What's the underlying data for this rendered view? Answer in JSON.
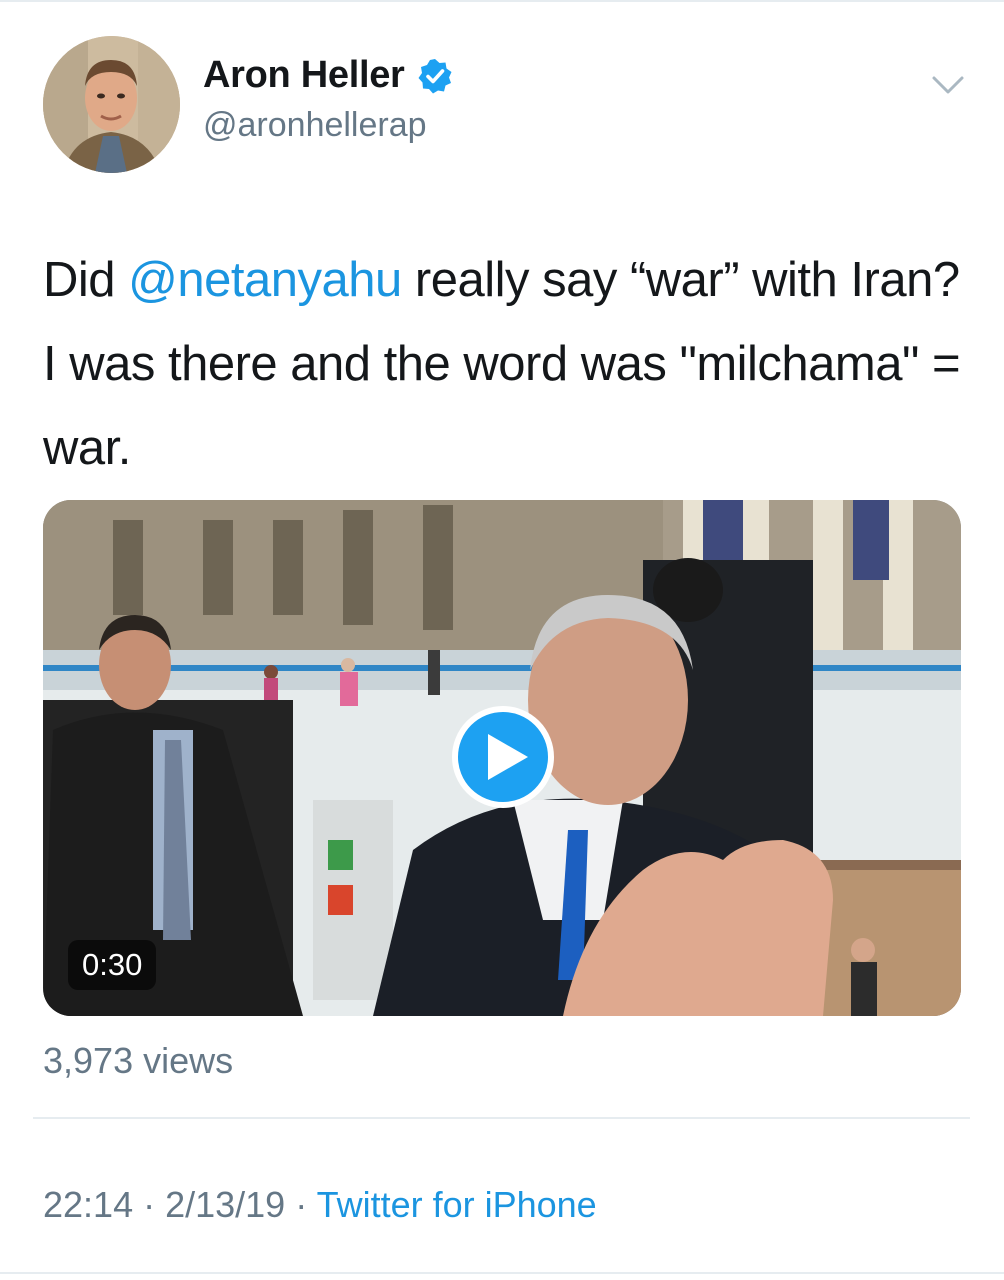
{
  "author": {
    "display_name": "Aron Heller",
    "handle": "@aronhellerap",
    "verified_icon": "verified-badge-icon"
  },
  "tweet": {
    "text_before": "Did ",
    "mention": "@netanyahu",
    "text_after": " really say “war” with Iran? I was there and the word was \"milchama\" = war."
  },
  "media": {
    "duration": "0:30",
    "play_icon": "play-icon"
  },
  "stats": {
    "views": "3,973 views"
  },
  "meta": {
    "time": "22:14",
    "separator1": " · ",
    "date": "2/13/19",
    "separator2": " · ",
    "source": "Twitter for iPhone"
  },
  "colors": {
    "accent": "#1da1f2",
    "link": "#1b95e0",
    "secondary_text": "#657786",
    "divider": "#e6ecf0"
  }
}
